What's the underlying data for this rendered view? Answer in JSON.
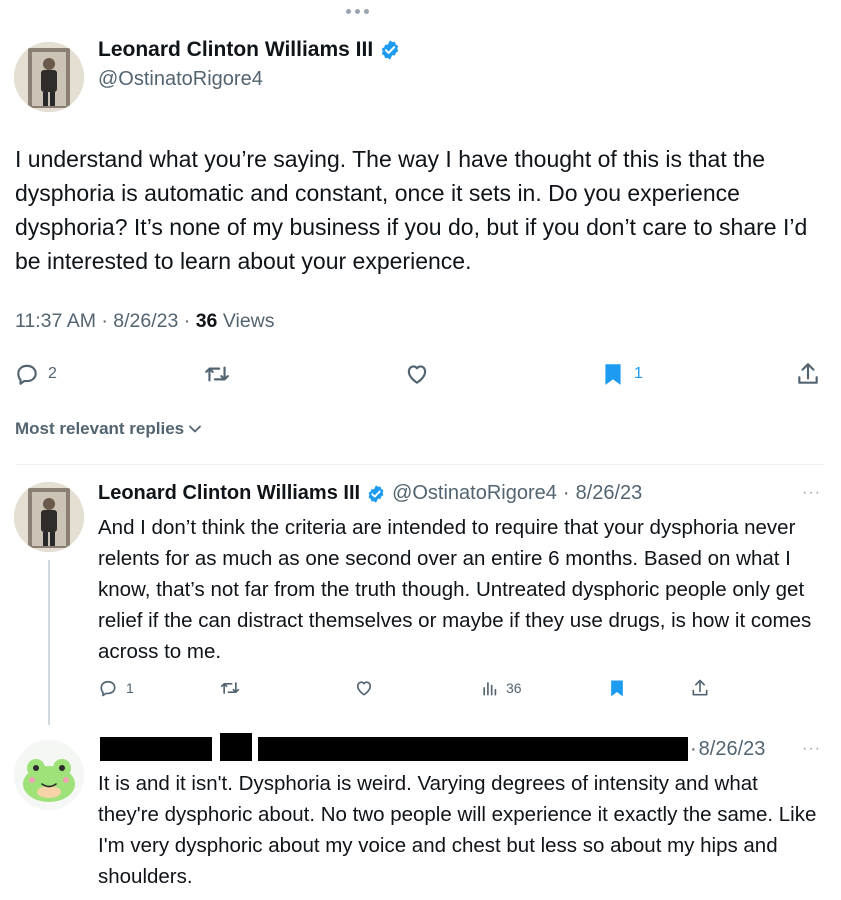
{
  "main_tweet": {
    "author_name": "Leonard Clinton Williams III",
    "handle": "@OstinatoRigore4",
    "text": "I understand what you’re saying. The way I have thought of this is that the dysphoria is automatic and constant, once it sets in. Do you experience dysphoria? It’s none of my business if you do, but if you don’t care to share I’d be interested to learn about your experience.",
    "time": "11:37 AM",
    "date": "8/26/23",
    "views_count": "36",
    "views_label": "Views",
    "actions": {
      "reply_count": "2",
      "retweet_count": "",
      "like_count": "",
      "bookmark_count": "1"
    }
  },
  "replies_header": {
    "label": "Most relevant replies"
  },
  "replies": [
    {
      "author_name": "Leonard Clinton Williams III",
      "handle": "@OstinatoRigore4",
      "date": "8/26/23",
      "text": "And I don’t think the criteria are intended to require that your dysphoria never relents for as much as one second over an entire 6 months. Based on what I know, that’s not far from the truth though. Untreated dysphoric people only get relief if the can distract themselves or maybe if they use drugs, is how it comes across to me.",
      "reply_count": "1",
      "views_count": "36"
    },
    {
      "author_name": "",
      "handle": "",
      "date": "8/26/23",
      "text": "It is and it isn't. Dysphoria is weird. Varying degrees of intensity and what they're dysphoric about. No two people will experience it exactly the same. Like I'm very dysphoric about my voice and chest but less so about my hips and shoulders."
    }
  ],
  "separators": {
    "dot": "·"
  },
  "colors": {
    "verified_blue": "#1d9bf0",
    "secondary_text": "#536471",
    "primary_text": "#0f1419",
    "frog_green": "#9fe27a"
  },
  "icons": {
    "reply": "speech-bubble-icon",
    "retweet": "retweet-icon",
    "like": "heart-icon",
    "bookmark": "bookmark-icon",
    "share": "share-icon",
    "views": "bar-chart-icon",
    "verified": "verified-badge-icon",
    "more": "ellipsis-icon",
    "chevron": "chevron-down-icon"
  }
}
